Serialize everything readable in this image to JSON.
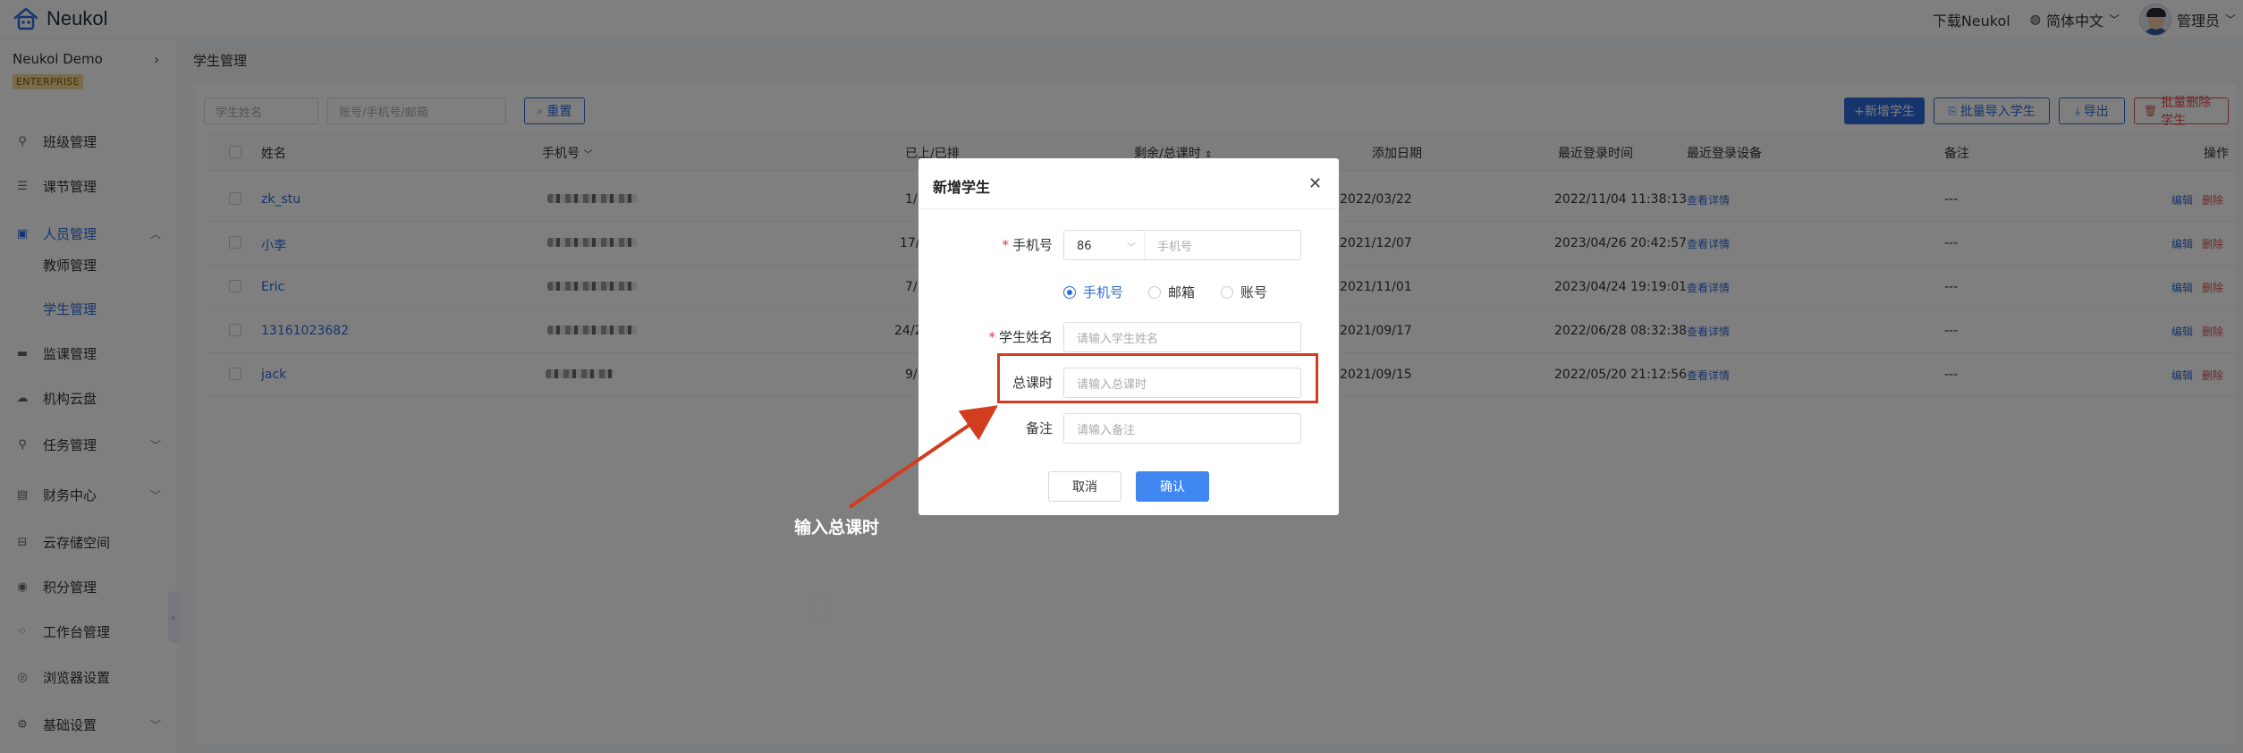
{
  "header": {
    "brand": "Neukol",
    "download": "下载Neukol",
    "language": "简体中文",
    "user": "管理员"
  },
  "sidebar": {
    "org_name": "Neukol Demo",
    "plan_badge": "ENTERPRISE",
    "items": [
      {
        "label": "班级管理",
        "icon": "class-icon"
      },
      {
        "label": "课节管理",
        "icon": "lesson-icon"
      },
      {
        "label": "人员管理",
        "icon": "people-icon",
        "expanded": true
      },
      {
        "label": "监课管理",
        "icon": "monitor-icon"
      },
      {
        "label": "机构云盘",
        "icon": "cloud-icon"
      },
      {
        "label": "任务管理",
        "icon": "task-icon"
      },
      {
        "label": "财务中心",
        "icon": "finance-icon"
      },
      {
        "label": "云存储空间",
        "icon": "storage-icon"
      },
      {
        "label": "积分管理",
        "icon": "points-icon"
      },
      {
        "label": "工作台管理",
        "icon": "workbench-icon"
      },
      {
        "label": "浏览器设置",
        "icon": "browser-icon"
      },
      {
        "label": "基础设置",
        "icon": "settings-icon"
      }
    ],
    "subitems": [
      {
        "label": "教师管理"
      },
      {
        "label": "学生管理",
        "active": true
      }
    ]
  },
  "main": {
    "breadcrumb": "学生管理",
    "filters": {
      "name_placeholder": "学生姓名",
      "account_placeholder": "账号/手机号/邮箱",
      "reset_label": "重置"
    },
    "actions": {
      "add": "+新增学生",
      "bulk_import": "批量导入学生",
      "export": "导出",
      "bulk_delete": "批量删除学生"
    },
    "table": {
      "columns": [
        "姓名",
        "手机号",
        "已上/已排",
        "剩余/总课时",
        "添加日期",
        "最近登录时间",
        "最近登录设备",
        "备注",
        "操作"
      ],
      "rows": [
        {
          "name": "zk_stu",
          "progress": "1/",
          "added": "2022/03/22",
          "last_login": "2022/11/04 11:38:13",
          "device": "查看详情",
          "note": "---",
          "edit": "编辑",
          "delete": "删除"
        },
        {
          "name": "小李",
          "progress": "17/1",
          "added": "2021/12/07",
          "last_login": "2023/04/26 20:42:57",
          "device": "查看详情",
          "note": "---",
          "edit": "编辑",
          "delete": "删除"
        },
        {
          "name": "Eric",
          "progress": "7/",
          "added": "2021/11/01",
          "last_login": "2023/04/24 19:19:01",
          "device": "查看详情",
          "note": "---",
          "edit": "编辑",
          "delete": "删除"
        },
        {
          "name": "13161023682",
          "progress": "24/2",
          "added": "2021/09/17",
          "last_login": "2022/06/28 08:32:38",
          "device": "查看详情",
          "note": "---",
          "edit": "编辑",
          "delete": "删除"
        },
        {
          "name": "jack",
          "progress": "9/",
          "added": "2021/09/15",
          "last_login": "2022/05/20 21:12:56",
          "device": "查看详情",
          "note": "---",
          "edit": "编辑",
          "delete": "删除"
        }
      ]
    }
  },
  "modal": {
    "title": "新增学生",
    "phone_label": "手机号",
    "country_code": "86",
    "phone_placeholder": "手机号",
    "radio_options": [
      "手机号",
      "邮箱",
      "账号"
    ],
    "name_label": "学生姓名",
    "name_placeholder": "请输入学生姓名",
    "hours_label": "总课时",
    "hours_placeholder": "请输入总课时",
    "note_label": "备注",
    "note_placeholder": "请输入备注",
    "cancel": "取消",
    "confirm": "确认"
  },
  "annotation": {
    "text": "输入总课时",
    "color": "#d33c1f"
  },
  "colors": {
    "primary": "#2d6bd8",
    "danger": "#d9534f"
  }
}
